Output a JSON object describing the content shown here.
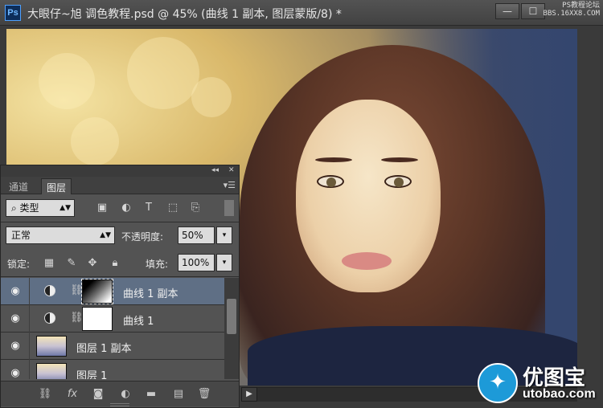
{
  "window": {
    "title": "大眼仔~旭 调色教程.psd @ 45% (曲线 1 副本, 图层蒙版/8) *",
    "app_logo": "Ps",
    "minimize": "—",
    "maximize": "☐",
    "watermark_line1": "PS教程论坛",
    "watermark_line2": "BBS.16XX8.COM"
  },
  "panel": {
    "tabs": [
      {
        "label": "通道",
        "active": false
      },
      {
        "label": "图层",
        "active": true
      }
    ],
    "filter_type": "类型",
    "blend_mode": "正常",
    "opacity_label": "不透明度:",
    "opacity_value": "50%",
    "lock_label": "锁定:",
    "fill_label": "填充:",
    "fill_value": "100%",
    "layers": [
      {
        "name": "曲线 1 副本",
        "type": "adjustment",
        "mask": "gradient",
        "selected": true,
        "visible": true
      },
      {
        "name": "曲线 1",
        "type": "adjustment",
        "mask": "white",
        "selected": false,
        "visible": true
      },
      {
        "name": "图层 1 副本",
        "type": "pixel",
        "selected": false,
        "visible": true
      },
      {
        "name": "图层 1",
        "type": "pixel",
        "selected": false,
        "visible": true
      }
    ]
  },
  "brand": {
    "name": "优图宝",
    "url": "utobao.com"
  },
  "colors": {
    "selected_layer": "#5f6f85",
    "panel_bg": "#535353",
    "brand_blue": "#1d9ad8"
  }
}
